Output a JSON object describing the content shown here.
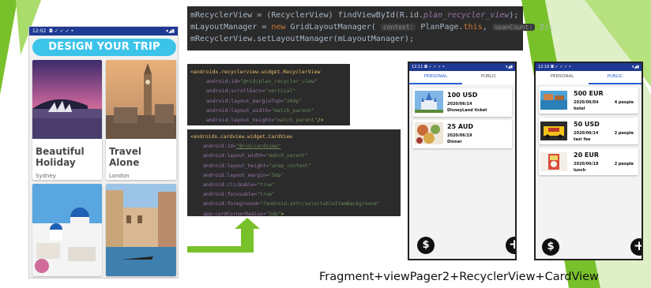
{
  "colors": {
    "accent_green": "#79c12b",
    "status_bar": "#1f3a93",
    "banner": "#3cc3ea",
    "code_bg": "#2b2b2b",
    "tab_active": "#2b5fd9"
  },
  "phone_gallery": {
    "status_time": "12:02",
    "status_icons": "◘ ✓ ✓ ✓ •",
    "status_right": "▾◢▮",
    "banner": "DESIGN YOUR TRIP",
    "cards": [
      {
        "title_line1": "Beautiful",
        "title_line2": "Holiday",
        "location": "Sydney",
        "image": "sydney-opera-house-image"
      },
      {
        "title_line1": "Travel",
        "title_line2": "Alone",
        "location": "London",
        "image": "london-big-ben-image"
      },
      {
        "image": "santorini-image"
      },
      {
        "image": "venice-canal-image"
      }
    ]
  },
  "code_java": {
    "line1": {
      "a": "mRecyclerView = (RecyclerView) findViewById(R.id.",
      "b": "plan_recycler_view",
      "c": ");"
    },
    "line2": {
      "a": "mLayoutManager = ",
      "kw": "new",
      "b": " GridLayoutManager( ",
      "h1": "context:",
      "c": " PlanPage.",
      "kw2": "this",
      "d": ",  ",
      "h2": "spanCount:",
      "e": " 2);"
    },
    "line3": "mRecyclerView.setLayoutManager(mLayoutManager);"
  },
  "code_recycler": {
    "tag": "<androidx.recyclerview.widget.RecyclerView",
    "lines": [
      {
        "attr": "android:id=",
        "val": "\"@+id/plan_recycler_view\""
      },
      {
        "attr": "android:scrollbars=",
        "val": "\"vertical\""
      },
      {
        "attr": "android:layout_marginTop=",
        "val": "\"10dp\""
      },
      {
        "attr": "android:layout_width=",
        "val": "\"match_parent\""
      },
      {
        "attr": "android:layout_height=",
        "val": "\"match_parent\"",
        "end": "/>"
      }
    ]
  },
  "code_cardview": {
    "tag": "<androidx.cardview.widget.CardView",
    "lines": [
      {
        "attr": "android:id=",
        "val": "\"@+id/cardview\""
      },
      {
        "attr": "android:layout_width=",
        "val": "\"match_parent\""
      },
      {
        "attr": "android:layout_height=",
        "val": "\"wrap_content\""
      },
      {
        "attr": "android:layout_margin=",
        "val": "\"5dp\""
      },
      {
        "attr": "android:clickable=",
        "val": "\"true\""
      },
      {
        "attr": "android:focusable=",
        "val": "\"true\""
      },
      {
        "attr": "android:foreground=",
        "val": "\"?android:attr/selectableItemBackground\""
      },
      {
        "attr": "app:cardCornerRadius=",
        "val": "\"5dp\"",
        "end": ">"
      }
    ]
  },
  "phone_personal": {
    "status_time": "12:11",
    "status_icons": "◘ ✓ ✓ ✓ •",
    "status_right": "▾◢▮",
    "tabs": [
      "PERSONAL",
      "PUBLIC"
    ],
    "active_tab": 0,
    "items": [
      {
        "amount": "100 USD",
        "date": "2020/06/14",
        "label": "DisneyLand ticket"
      },
      {
        "amount": "25 AUD",
        "date": "2020/06/19",
        "label": "Dinner"
      }
    ],
    "fab_left": "$",
    "fab_right": "+"
  },
  "phone_public": {
    "status_time": "12:16",
    "status_icons": "◘ ✓ ✓ ✓ •",
    "status_right": "▾◢▮",
    "tabs": [
      "PERSONAL",
      "PUBLIC"
    ],
    "active_tab": 1,
    "items": [
      {
        "amount": "500 EUR",
        "date": "2020/06/04",
        "label": "hotel",
        "people": "4 people"
      },
      {
        "amount": "50 USD",
        "date": "2020/06/14",
        "label": "taxi fee",
        "people": "2 people"
      },
      {
        "amount": "20 EUR",
        "date": "2020/06/18",
        "label": "lunch",
        "people": "2 people"
      }
    ],
    "fab_left": "$",
    "fab_right": "+"
  },
  "caption": "Fragment+viewPager2+RecyclerView+CardView"
}
